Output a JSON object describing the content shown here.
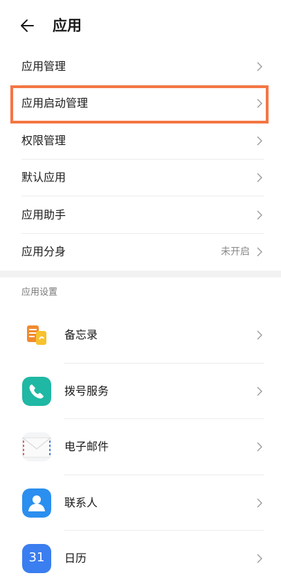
{
  "header": {
    "title": "应用"
  },
  "menu": [
    {
      "label": "应用管理",
      "value": ""
    },
    {
      "label": "应用启动管理",
      "value": ""
    },
    {
      "label": "权限管理",
      "value": ""
    },
    {
      "label": "默认应用",
      "value": ""
    },
    {
      "label": "应用助手",
      "value": ""
    },
    {
      "label": "应用分身",
      "value": "未开启"
    }
  ],
  "highlight_color": "#f47644",
  "section": {
    "title": "应用设置"
  },
  "apps": [
    {
      "label": "备忘录",
      "icon": "notepad-icon"
    },
    {
      "label": "拨号服务",
      "icon": "phone-icon"
    },
    {
      "label": "电子邮件",
      "icon": "envelope-icon"
    },
    {
      "label": "联系人",
      "icon": "contacts-icon"
    },
    {
      "label": "日历",
      "icon": "calendar-icon",
      "icon_text": "31"
    }
  ]
}
